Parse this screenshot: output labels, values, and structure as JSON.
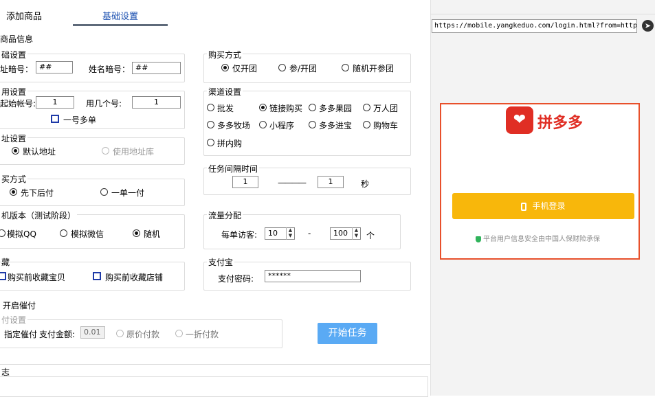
{
  "tabs": [
    {
      "label": "添加商品"
    },
    {
      "label": "基础设置"
    }
  ],
  "section_title": "商品信息",
  "basic": {
    "title": "础设置",
    "addr_code_label": "址暗号：",
    "addr_code_value": "##",
    "name_code_label": "姓名暗号：",
    "name_code_value": "##"
  },
  "account": {
    "title": "用设置",
    "start_label": "起始帐号:",
    "start_value": "1",
    "count_label": "用几个号:",
    "count_value": "1",
    "multi_label": "一号多单"
  },
  "address": {
    "title": "址设置",
    "default_label": "默认地址",
    "lib_label": "使用地址库"
  },
  "pay_method": {
    "title": "买方式",
    "option1": "先下后付",
    "option2": "一单一付"
  },
  "phone_version": {
    "title": "机版本（测试阶段）",
    "option1": "模拟QQ",
    "option2": "模拟微信",
    "option3": "随机"
  },
  "favorite": {
    "title": "藏",
    "option1": "购买前收藏宝贝",
    "option2": "购买前收藏店铺"
  },
  "urge": {
    "label": "开启催付",
    "sub_title": "付设置",
    "specify_label": "指定催付",
    "amount_label": "支付金额:",
    "amount_value": "0.01",
    "original_label": "原价付款",
    "discount_label": "一折付款"
  },
  "buy_mode": {
    "title": "购买方式",
    "option1": "仅开团",
    "option2": "参/开团",
    "option3": "随机开参团"
  },
  "channel": {
    "title": "渠道设置",
    "options": [
      "批发",
      "链接购买",
      "多多果园",
      "万人团",
      "多多牧场",
      "小程序",
      "多多进宝",
      "购物车",
      "拼内购"
    ]
  },
  "interval": {
    "title": "任务间隔时间",
    "from": "1",
    "dash": "————",
    "to": "1",
    "unit": "秒"
  },
  "traffic": {
    "title": "流量分配",
    "label": "每单访客:",
    "min": "10",
    "sep": "-",
    "max": "100",
    "unit": "个"
  },
  "alipay": {
    "title": "支付宝",
    "label": "支付密码:",
    "value": "******"
  },
  "start_button": "开始任务",
  "log_title": "志",
  "browser": {
    "url": "https://mobile.yangkeduo.com/login.html?from=https%3A",
    "go_icon": "arrow-right-icon"
  },
  "pdd": {
    "brand": "拼多多",
    "login_button": "手机登录",
    "secure_text": "平台用户信息安全由中国人保财险承保"
  },
  "colors": {
    "brand_red": "#e02e24",
    "login_yellow": "#f8b70b",
    "start_blue": "#5aaaf4",
    "highlight_border": "#e8502b"
  }
}
